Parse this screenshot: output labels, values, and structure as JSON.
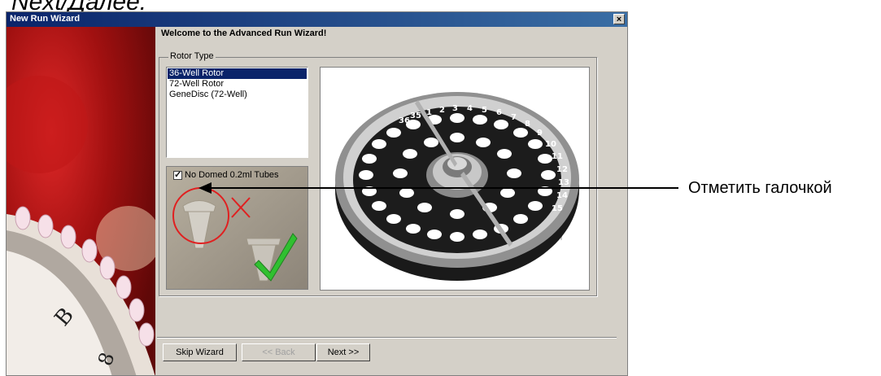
{
  "caption": {
    "top_text": "Next/Далее."
  },
  "window": {
    "title": "New Run Wizard",
    "close_glyph": "×"
  },
  "wizard": {
    "welcome": "Welcome to the Advanced Run Wizard!",
    "rotor_group_label": "Rotor Type",
    "rotor_options": [
      "36-Well Rotor",
      "72-Well Rotor",
      "GeneDisc (72-Well)"
    ],
    "selected_rotor_index": 0,
    "checkbox_label": "No Domed 0.2ml Tubes",
    "checkbox_checked": true
  },
  "buttons": {
    "skip": "Skip Wizard",
    "back": "<< Back",
    "next": "Next >>"
  },
  "annotation": {
    "text": "Отметить галочкой"
  },
  "colors": {
    "title_bar": "#0a246a",
    "dialog_bg": "#d4d0c8",
    "selection": "#0a246a",
    "cross_mark": "#e02020",
    "check_mark": "#30c030"
  },
  "rotor_numbers": [
    "1",
    "2",
    "3",
    "4",
    "5",
    "6",
    "7",
    "8",
    "9",
    "10",
    "11",
    "12",
    "13",
    "14",
    "15",
    "36",
    "35"
  ],
  "side_image_letters": [
    "B",
    "8"
  ]
}
